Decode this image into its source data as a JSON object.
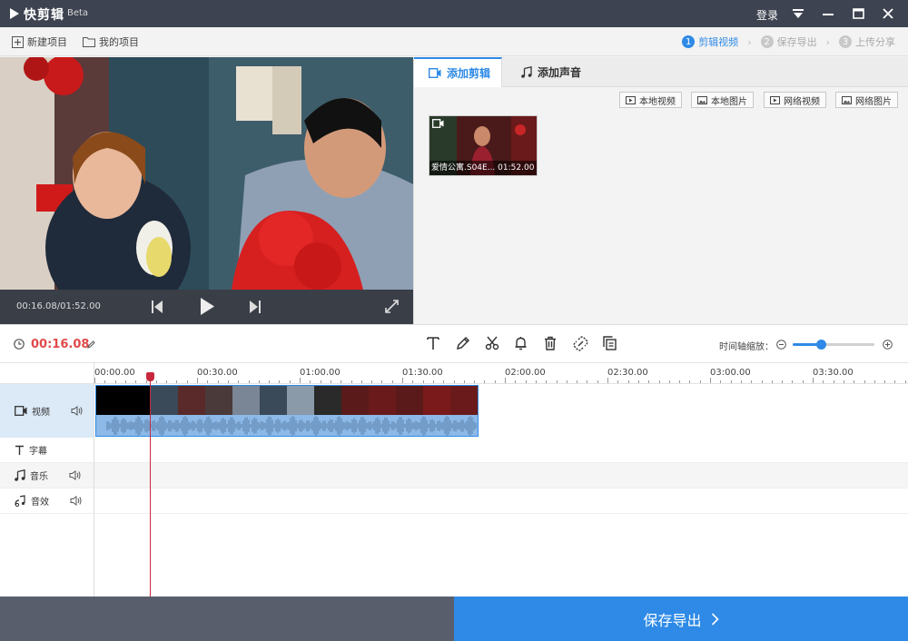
{
  "app": {
    "name": "快剪辑",
    "badge": "Beta"
  },
  "titlebar": {
    "login": "登录"
  },
  "menubar": {
    "new_project": "新建项目",
    "my_projects": "我的项目",
    "steps": [
      {
        "num": "1",
        "label": "剪辑视频"
      },
      {
        "num": "2",
        "label": "保存导出"
      },
      {
        "num": "3",
        "label": "上传分享"
      }
    ]
  },
  "player": {
    "time": "00:16.08/01:52.00"
  },
  "panel": {
    "tabs": [
      "添加剪辑",
      "添加声音"
    ],
    "sources": [
      "本地视频",
      "本地图片",
      "网络视频",
      "网络图片"
    ],
    "clip": {
      "name": "爱情公寓.S04E...",
      "duration": "01:52.00"
    }
  },
  "toolbar": {
    "current_time": "00:16.08",
    "zoom_label": "时间轴缩放：",
    "zoom_level": 0.35
  },
  "timeline": {
    "ticks": [
      "00:00.00",
      "00:30.00",
      "01:00.00",
      "01:30.00",
      "02:00.00",
      "02:30.00",
      "03:00.00",
      "03:30.00"
    ],
    "tracks": [
      "视频",
      "字幕",
      "音乐",
      "音效"
    ]
  },
  "footer": {
    "save_export": "保存导出"
  },
  "colors": {
    "accent": "#2e8ae6",
    "time_red": "#e04a4a",
    "titlebar": "#3d4350"
  }
}
